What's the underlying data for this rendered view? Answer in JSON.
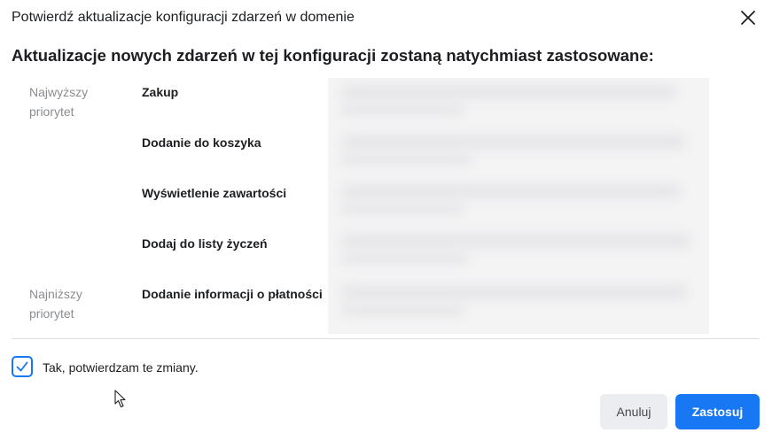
{
  "dialog": {
    "title": "Potwierdź aktualizacje konfiguracji zdarzeń w domenie",
    "heading": "Aktualizacje nowych zdarzeń w tej konfiguracji zostaną natychmiast zastosowane:"
  },
  "priorities": {
    "highest": "Najwyższy priorytet",
    "lowest": "Najniższy priorytet"
  },
  "events": [
    {
      "label": "Zakup"
    },
    {
      "label": "Dodanie do koszyka"
    },
    {
      "label": "Wyświetlenie zawartości"
    },
    {
      "label": "Dodaj do listy życzeń"
    },
    {
      "label": "Dodanie informacji o płatności"
    }
  ],
  "confirmation": {
    "checked": true,
    "label": "Tak, potwierdzam te zmiany."
  },
  "buttons": {
    "cancel": "Anuluj",
    "apply": "Zastosuj"
  },
  "colors": {
    "accent": "#1877f2",
    "muted_text": "#8a8d91",
    "cancel_bg": "#ebedf0"
  },
  "icons": {
    "close": "close-icon",
    "check": "checkmark-icon",
    "cursor": "mouse-pointer-icon"
  }
}
